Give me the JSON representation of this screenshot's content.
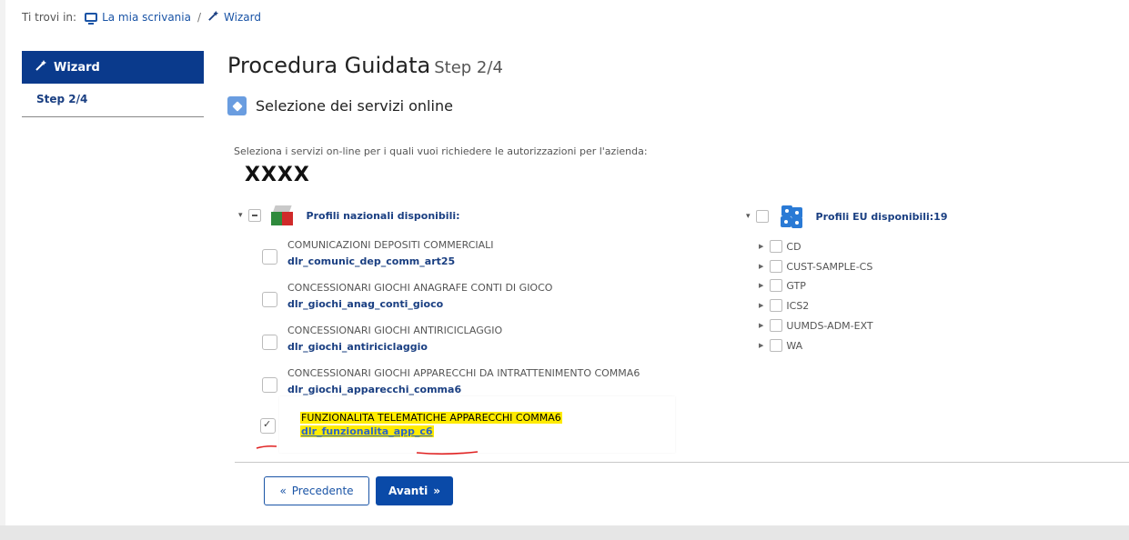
{
  "breadcrumb": {
    "prefix": "Ti trovi in:",
    "home_label": "La mia scrivania",
    "separator": "/",
    "current_label": "Wizard"
  },
  "sidebar": {
    "header_label": "Wizard",
    "items": [
      {
        "label": "Step 2/4"
      }
    ]
  },
  "main": {
    "title": "Procedura Guidata",
    "step": "Step 2/4",
    "section_title": "Selezione dei servizi online",
    "instructions": "Seleziona i servizi on-line per i quali vuoi richiedere le autorizzazioni per l'azienda:",
    "company_name": "XXXX"
  },
  "national_profiles": {
    "label": "Profili nazionali disponibili:",
    "services": [
      {
        "name": "COMUNICAZIONI DEPOSITI COMMERCIALI",
        "code": "dlr_comunic_dep_comm_art25",
        "checked": false
      },
      {
        "name": "CONCESSIONARI GIOCHI ANAGRAFE CONTI DI GIOCO",
        "code": "dlr_giochi_anag_conti_gioco",
        "checked": false
      },
      {
        "name": "CONCESSIONARI GIOCHI ANTIRICICLAGGIO",
        "code": "dlr_giochi_antiriciclaggio",
        "checked": false
      },
      {
        "name": "CONCESSIONARI GIOCHI APPARECCHI DA INTRATTENIMENTO COMMA6",
        "code": "dlr_giochi_apparecchi_comma6",
        "checked": false
      },
      {
        "name": "FUNZIONALITA TELEMATICHE APPARECCHI COMMA6",
        "code": "dlr_funzionalita_app_c6",
        "checked": true
      }
    ]
  },
  "eu_profiles": {
    "label": "Profili EU disponibili:19",
    "items": [
      {
        "label": "CD"
      },
      {
        "label": "CUST-SAMPLE-CS"
      },
      {
        "label": "GTP"
      },
      {
        "label": "ICS2"
      },
      {
        "label": "UUMDS-ADM-EXT"
      },
      {
        "label": "WA"
      }
    ]
  },
  "buttons": {
    "previous_label": "Precedente",
    "next_label": "Avanti"
  },
  "colors": {
    "primary": "#0a4aa8",
    "sidebar_header": "#0a3a8c",
    "highlight": "#ffeb00",
    "annotation_red": "#e02020"
  }
}
